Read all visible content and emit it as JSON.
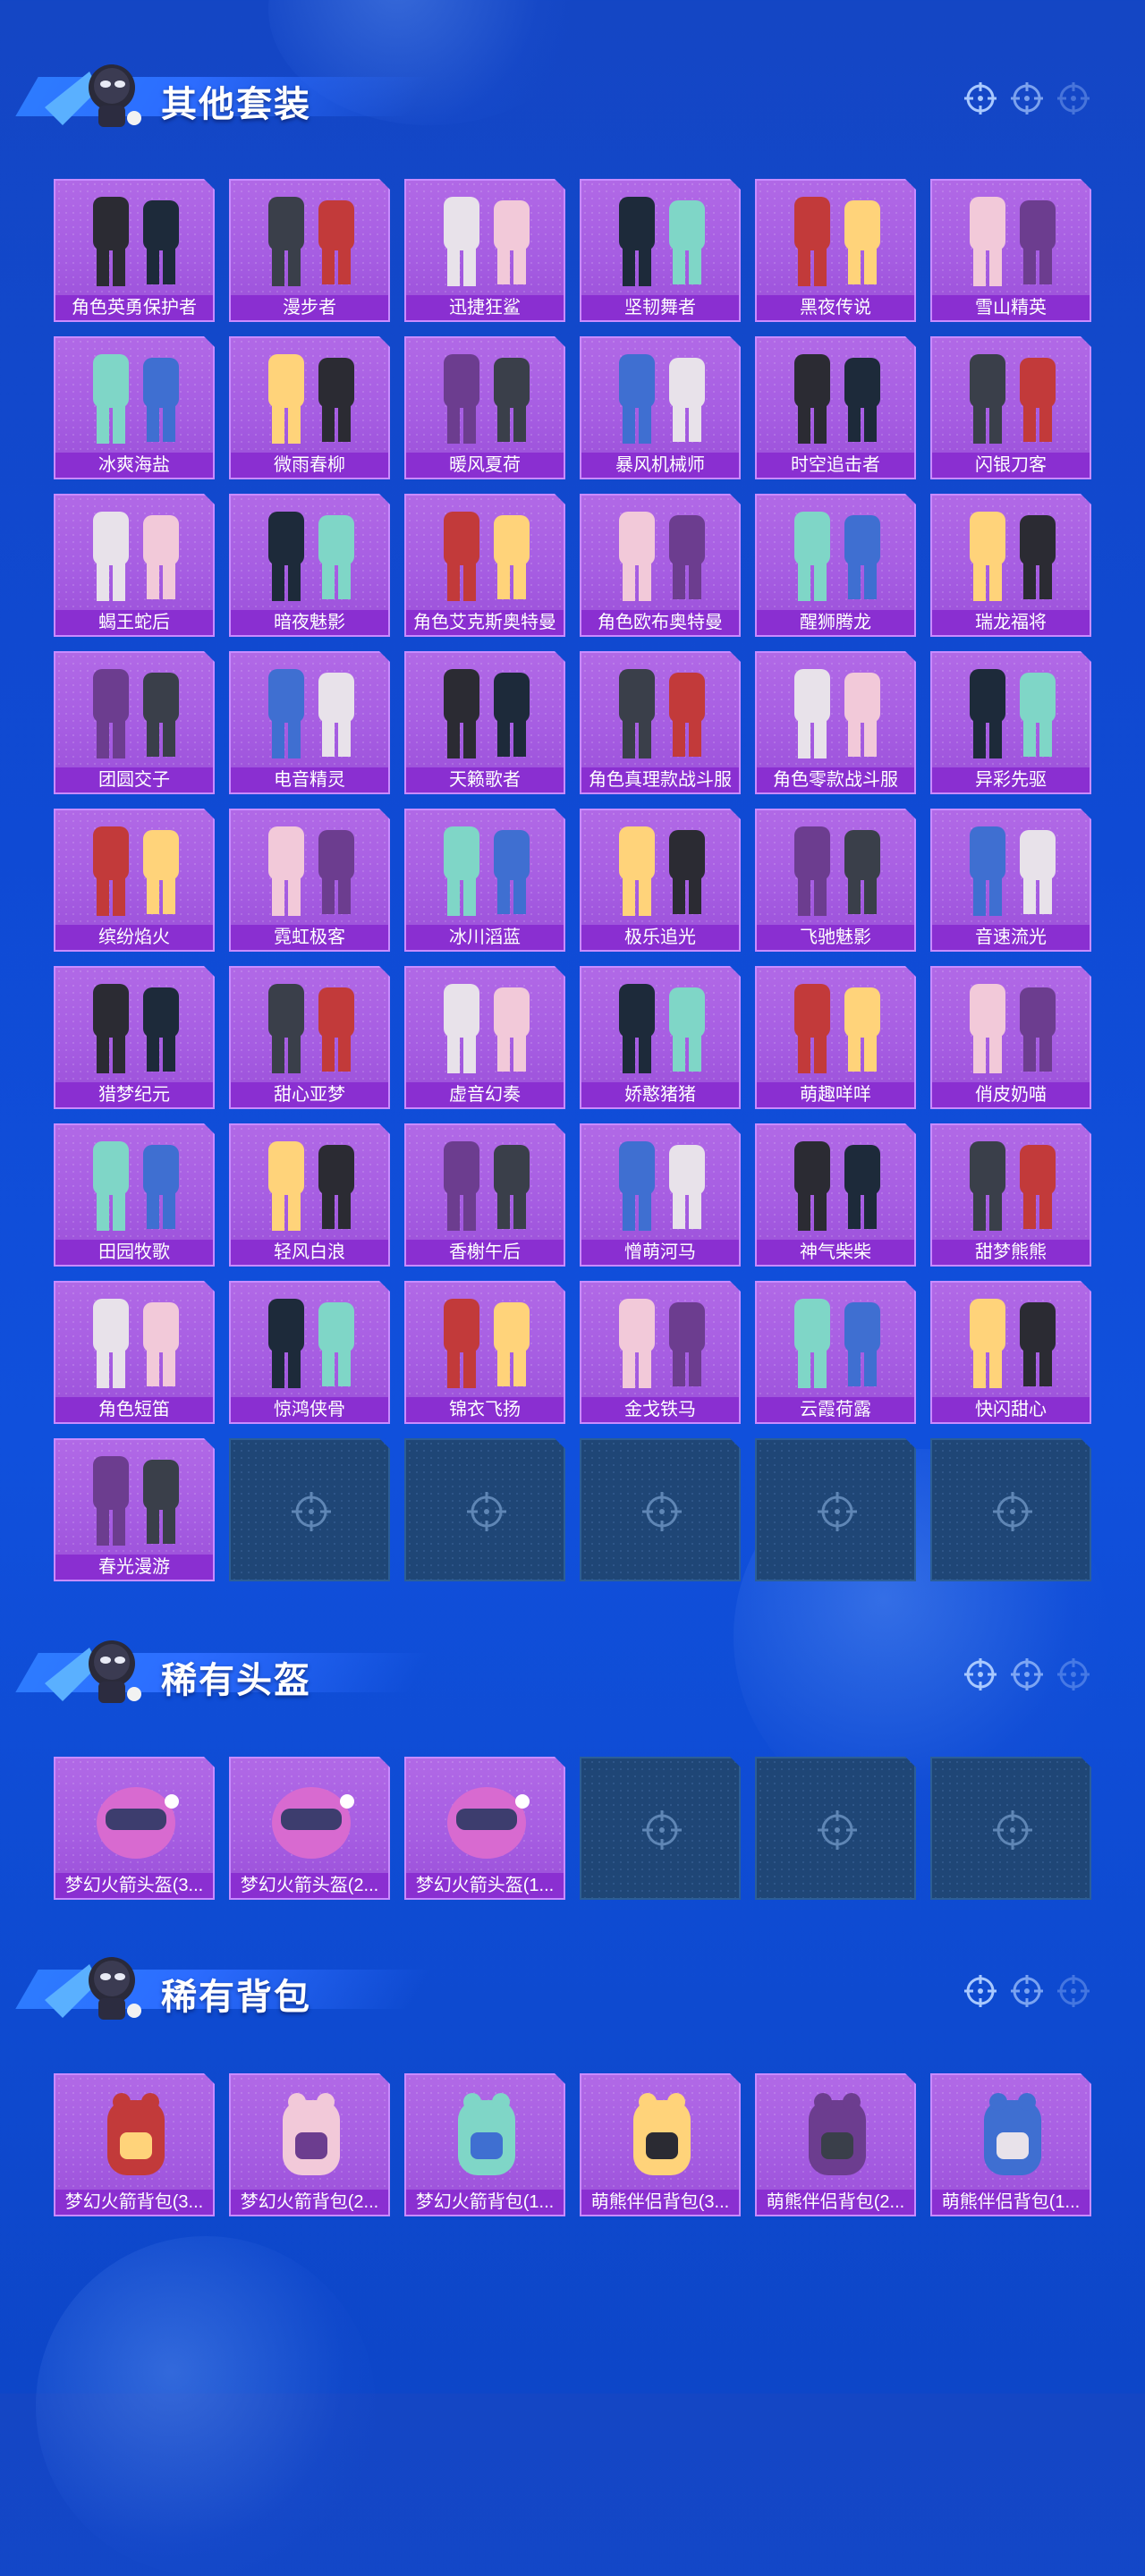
{
  "sections": [
    {
      "id": "other_suits",
      "title": "其他套装",
      "items": [
        "角色英勇保护者",
        "漫步者",
        "迅捷狂鲨",
        "坚韧舞者",
        "黑夜传说",
        "雪山精英",
        "冰爽海盐",
        "微雨春柳",
        "暖风夏荷",
        "暴风机械师",
        "时空追击者",
        "闪银刀客",
        "蝎王蛇后",
        "暗夜魅影",
        "角色艾克斯奥特曼",
        "角色欧布奥特曼",
        "醒狮腾龙",
        "瑞龙福将",
        "团圆交子",
        "电音精灵",
        "天籁歌者",
        "角色真理款战斗服",
        "角色零款战斗服",
        "异彩先驱",
        "缤纷焰火",
        "霓虹极客",
        "冰川滔蓝",
        "极乐追光",
        "飞驰魅影",
        "音速流光",
        "猎梦纪元",
        "甜心亚梦",
        "虚音幻奏",
        "娇憨猪猪",
        "萌趣咩咩",
        "俏皮奶喵",
        "田园牧歌",
        "轻风白浪",
        "香榭午后",
        "憎萌河马",
        "神气柴柴",
        "甜梦熊熊",
        "角色短笛",
        "惊鸿侠骨",
        "锦衣飞扬",
        "金戈铁马",
        "云霞荷露",
        "快闪甜心",
        "春光漫游"
      ],
      "empty_slots": 5
    },
    {
      "id": "rare_helmets",
      "title": "稀有头盔",
      "items": [
        "梦幻火箭头盔(3...",
        "梦幻火箭头盔(2...",
        "梦幻火箭头盔(1..."
      ],
      "empty_slots": 3
    },
    {
      "id": "rare_backpacks",
      "title": "稀有背包",
      "items": [
        "梦幻火箭背包(3...",
        "梦幻火箭背包(2...",
        "梦幻火箭背包(1...",
        "萌熊伴侣背包(3...",
        "萌熊伴侣背包(2...",
        "萌熊伴侣背包(1..."
      ],
      "empty_slots": 0
    }
  ],
  "colors": {
    "background": "#0f4ad4",
    "card": "#a65de2",
    "card_label": "#8a2fd1",
    "empty_slot": "#1f4676"
  }
}
